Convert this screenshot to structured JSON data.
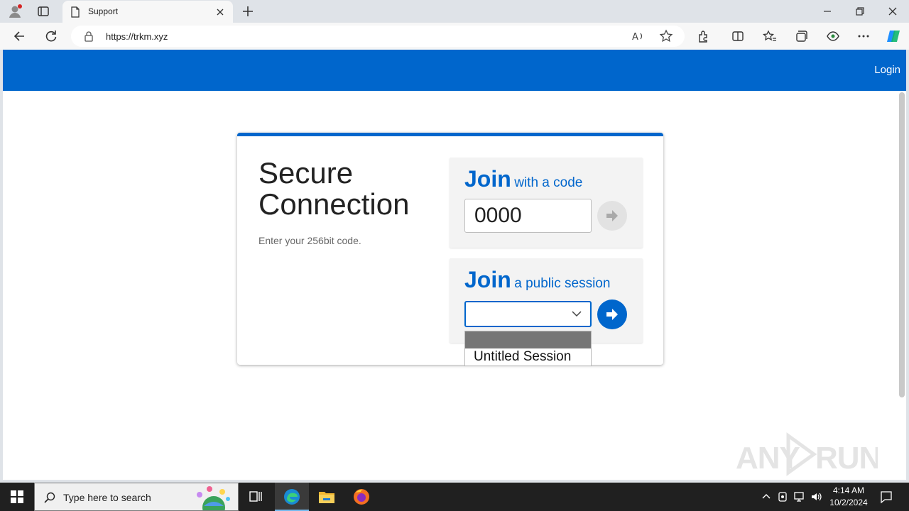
{
  "browser": {
    "tab_title": "Support",
    "url": "https://trkm.xyz"
  },
  "page": {
    "nav_login": "Login",
    "heading_line1": "Secure",
    "heading_line2": "Connection",
    "subtext": "Enter your 256bit code.",
    "code_panel": {
      "title_big": "Join",
      "title_small": "with a code",
      "code_value": "0000"
    },
    "public_panel": {
      "title_big": "Join",
      "title_small": "a public session",
      "selected_value": "",
      "options": [
        "",
        "Untitled Session"
      ]
    },
    "watermark": "ANY RUN",
    "colors": {
      "accent": "#0066cc",
      "disabled_button": "#e2e2e2"
    }
  },
  "taskbar": {
    "search_placeholder": "Type here to search",
    "apps": [
      "task-view-icon",
      "edge-icon",
      "file-explorer-icon",
      "firefox-icon"
    ],
    "time": "4:14 AM",
    "date": "10/2/2024"
  }
}
